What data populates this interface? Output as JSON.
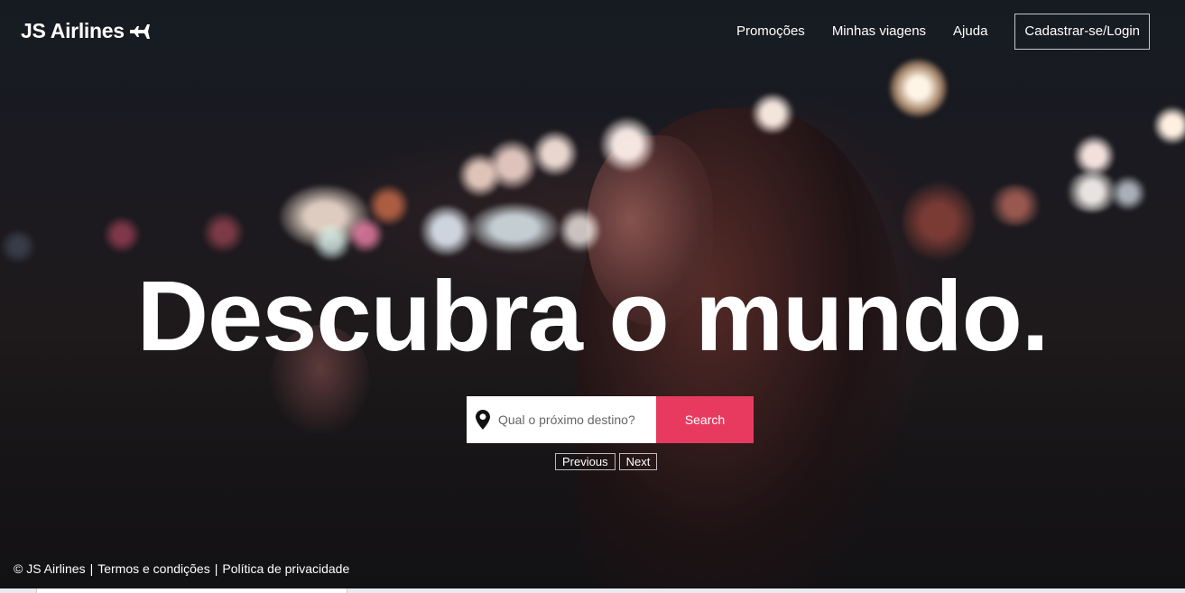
{
  "header": {
    "logo_text": "JS Airlines",
    "logo_icon": "airplane-icon",
    "nav": {
      "promotions": "Promoções",
      "my_trips": "Minhas viagens",
      "help": "Ajuda",
      "login": "Cadastrar-se/Login"
    }
  },
  "hero": {
    "headline": "Descubra o mundo."
  },
  "search": {
    "icon": "map-pin-icon",
    "placeholder": "Qual o próximo destino?",
    "button_label": "Search"
  },
  "carousel": {
    "previous_label": "Previous",
    "next_label": "Next"
  },
  "footer": {
    "copyright": "© JS Airlines",
    "separator": "|",
    "terms": "Termos e condições",
    "privacy": "Política de privacidade"
  },
  "colors": {
    "accent": "#e83a5f",
    "text": "#ffffff",
    "background": "#151418"
  }
}
